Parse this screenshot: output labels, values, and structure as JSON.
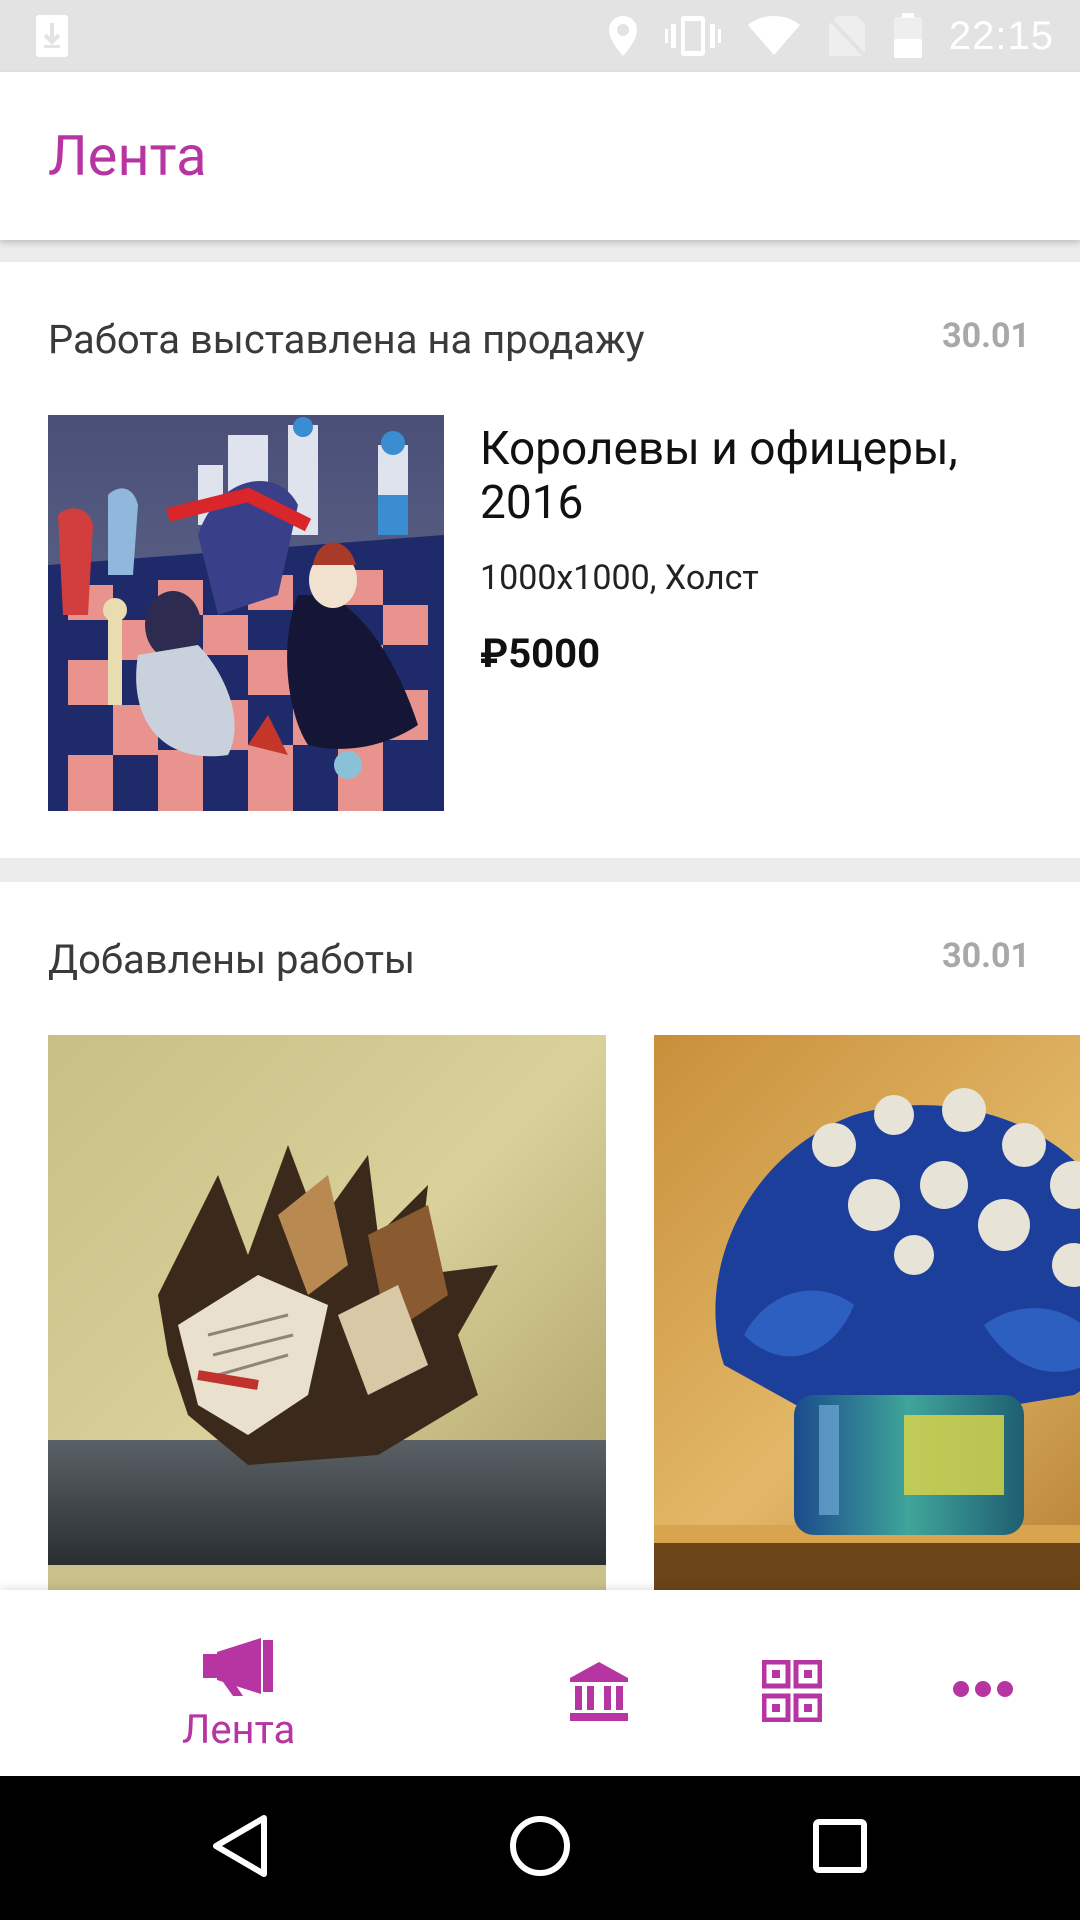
{
  "status_bar": {
    "time": "22:15",
    "left_icons": [
      "download-notification-icon"
    ],
    "right_icons": [
      "location-icon",
      "vibrate-icon",
      "wifi-icon",
      "no-sim-icon",
      "battery-icon"
    ]
  },
  "app_bar": {
    "title": "Лента"
  },
  "feed": {
    "sale_card": {
      "title": "Работа выставлена на продажу",
      "date": "30.01",
      "artwork": {
        "title": "Королевы и офицеры, 2016",
        "meta": "1000x1000, Холст",
        "price": "₽5000"
      }
    },
    "added_card": {
      "title": "Добавлены работы",
      "date": "30.01"
    }
  },
  "bottom_nav": {
    "items": [
      {
        "label": "Лента",
        "icon": "megaphone-icon",
        "active": true
      },
      {
        "label": "",
        "icon": "museum-icon",
        "active": false
      },
      {
        "label": "",
        "icon": "qr-code-icon",
        "active": false
      },
      {
        "label": "",
        "icon": "more-dots-icon",
        "active": false
      }
    ]
  },
  "colors": {
    "accent": "#b735a3",
    "status_bar_bg": "#e3e3e3",
    "feed_bg": "#ececec",
    "date_text": "#a8a8a8",
    "system_nav_bg": "#000000"
  }
}
